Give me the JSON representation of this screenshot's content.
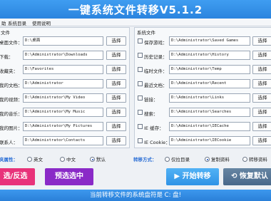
{
  "window": {
    "title": "一键系统文件转移V5.1.2"
  },
  "menu": {
    "items": [
      "助",
      "系统目录",
      "使用说明"
    ]
  },
  "left_panel": {
    "title": "文件",
    "rows": [
      {
        "label": "桌面文件：",
        "path": "D:\\桌面",
        "button": "选择"
      },
      {
        "label": "下载：",
        "path": "D:\\Administrator\\Downloads",
        "button": "选择"
      },
      {
        "label": "收藏夹：",
        "path": "D:\\Favorites",
        "button": "选择"
      },
      {
        "label": "我的文档：",
        "path": "D:\\Administrator",
        "button": "选择"
      },
      {
        "label": "我的视频：",
        "path": "D:\\Administrator\\My Video",
        "button": "选择"
      },
      {
        "label": "我的音乐：",
        "path": "D:\\Administrator\\My Music",
        "button": "选择"
      },
      {
        "label": "我的图片：",
        "path": "D:\\Administrator\\My Pictures",
        "button": "选择"
      },
      {
        "label": "联系人：",
        "path": "D:\\Administrator\\Contacts",
        "button": "选择"
      }
    ]
  },
  "right_panel": {
    "title": "系统文件",
    "rows": [
      {
        "label": "保存游戏：",
        "path": "D:\\Administrator\\Saved Games",
        "button": "选择"
      },
      {
        "label": "历史记录：",
        "path": "D:\\Administrator\\History",
        "button": "选择"
      },
      {
        "label": "临时文件：",
        "path": "D:\\Administrator\\Temp",
        "button": "选择"
      },
      {
        "label": "最近文档：",
        "path": "D:\\Administrator\\Recent",
        "button": "选择"
      },
      {
        "label": "链接：",
        "path": "D:\\Administrator\\Links",
        "button": "选择"
      },
      {
        "label": "搜索：",
        "path": "D:\\Administrator\\Searches",
        "button": "选择"
      },
      {
        "label": "IE 缓存：",
        "path": "D:\\Administrator\\IECache",
        "button": "选择"
      },
      {
        "label": "IE Cookie：",
        "path": "D:\\Administrator\\IECookie",
        "button": "选择"
      }
    ]
  },
  "options": {
    "attr_label": "夹属性：",
    "attr_choices": [
      "英文",
      "中文",
      "默认"
    ],
    "attr_selected": "默认",
    "mode_label": "转移方式：",
    "mode_choices": [
      "仅拉目录",
      "复制资料",
      "转移资料"
    ],
    "mode_selected": "复制资料"
  },
  "actions": {
    "select_toggle": "选/反选",
    "preselect": "预选选中",
    "start": "▶  开始转移",
    "restore": "⟲  恢复默认"
  },
  "status": {
    "text": "当前转移文件的系统盘符是 C: 盘!"
  },
  "colors": {
    "title_bar": "#2b84de",
    "select_toggle": "#e8327a",
    "preselect": "#8a2ac7",
    "start": "#3ba0ee",
    "restore": "#4f6f8f"
  }
}
